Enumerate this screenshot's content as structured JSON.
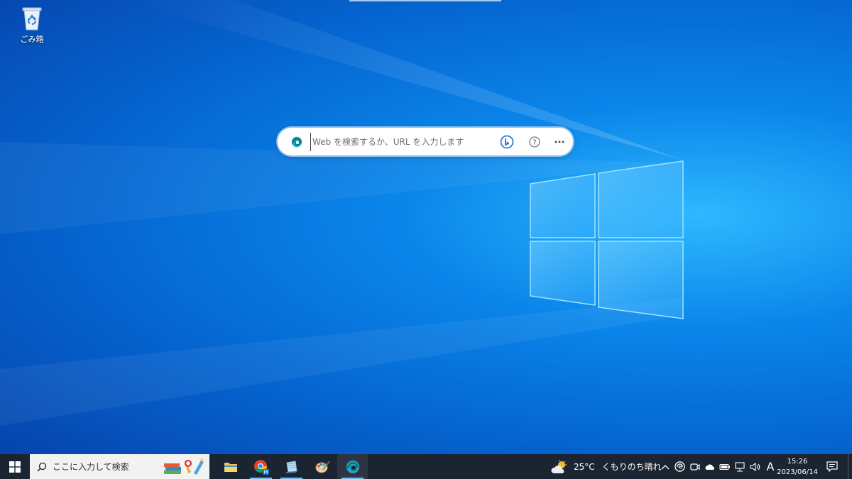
{
  "desktop": {
    "icons": [
      {
        "label": "ごみ箱",
        "icon": "recycle-bin-icon"
      }
    ]
  },
  "edge_search": {
    "placeholder": "Web を検索するか、URL を入力します",
    "value": "",
    "icons": [
      "edge-logo-icon",
      "bing-icon",
      "help-icon",
      "more-icon"
    ]
  },
  "taskbar": {
    "start_icon": "windows-start-icon",
    "search_placeholder": "ここに入力して検索",
    "apps": [
      {
        "name": "file-explorer",
        "icon": "folder-icon",
        "running": false
      },
      {
        "name": "chrome",
        "icon": "chrome-icon",
        "running": true
      },
      {
        "name": "notepad-app",
        "icon": "notebook-icon",
        "running": true
      },
      {
        "name": "paint-app",
        "icon": "palette-icon",
        "running": false
      },
      {
        "name": "edge",
        "icon": "edge-icon",
        "running": true
      }
    ],
    "weather": {
      "temp": "25°C",
      "desc": "くもりのち晴れ",
      "icon": "partly-cloudy-icon"
    },
    "tray": {
      "icons": [
        "chevron-up-icon",
        "edge-tray-icon",
        "meet-icon",
        "onedrive-icon",
        "battery-icon",
        "network-icon",
        "volume-icon"
      ],
      "ime": "A"
    },
    "clock": {
      "time": "15:26",
      "date": "2023/06/14"
    }
  },
  "colors": {
    "desktop_accent": "#0a86ea",
    "taskbar_bg": "#1b2431",
    "running_indicator": "#76b9ed"
  }
}
